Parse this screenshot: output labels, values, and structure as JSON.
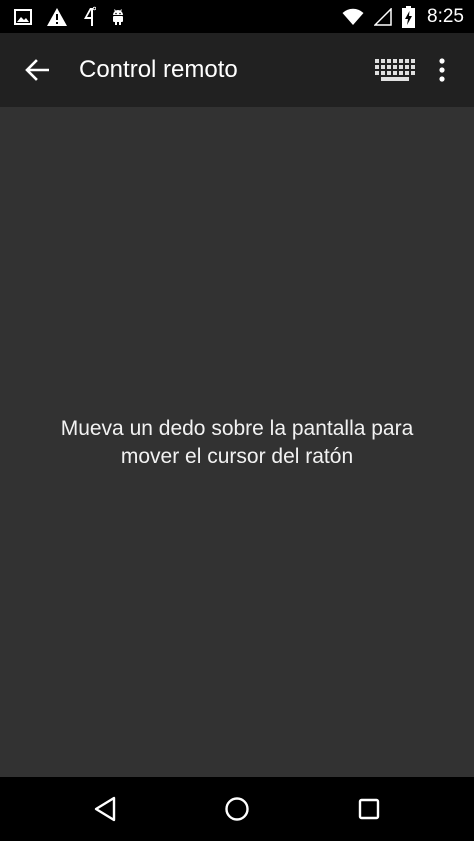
{
  "status_bar": {
    "time": "8:25",
    "icons": [
      "image-icon",
      "warning-icon",
      "signal-4g-icon",
      "android-icon",
      "wifi-icon",
      "cell-signal-icon",
      "battery-charging-icon"
    ]
  },
  "app_bar": {
    "title": "Control remoto",
    "icons": [
      "back-arrow-icon",
      "keyboard-icon",
      "more-vert-icon"
    ]
  },
  "content": {
    "hint_line1": "Mueva un dedo sobre la pantalla para",
    "hint_line2": "mover el cursor del ratón"
  },
  "nav_bar": {
    "icons": [
      "back-triangle-icon",
      "home-circle-icon",
      "recents-square-icon"
    ]
  },
  "colors": {
    "status_bar_bg": "#000000",
    "app_bar_bg": "#212121",
    "content_bg": "#323232",
    "text": "#ffffff"
  }
}
